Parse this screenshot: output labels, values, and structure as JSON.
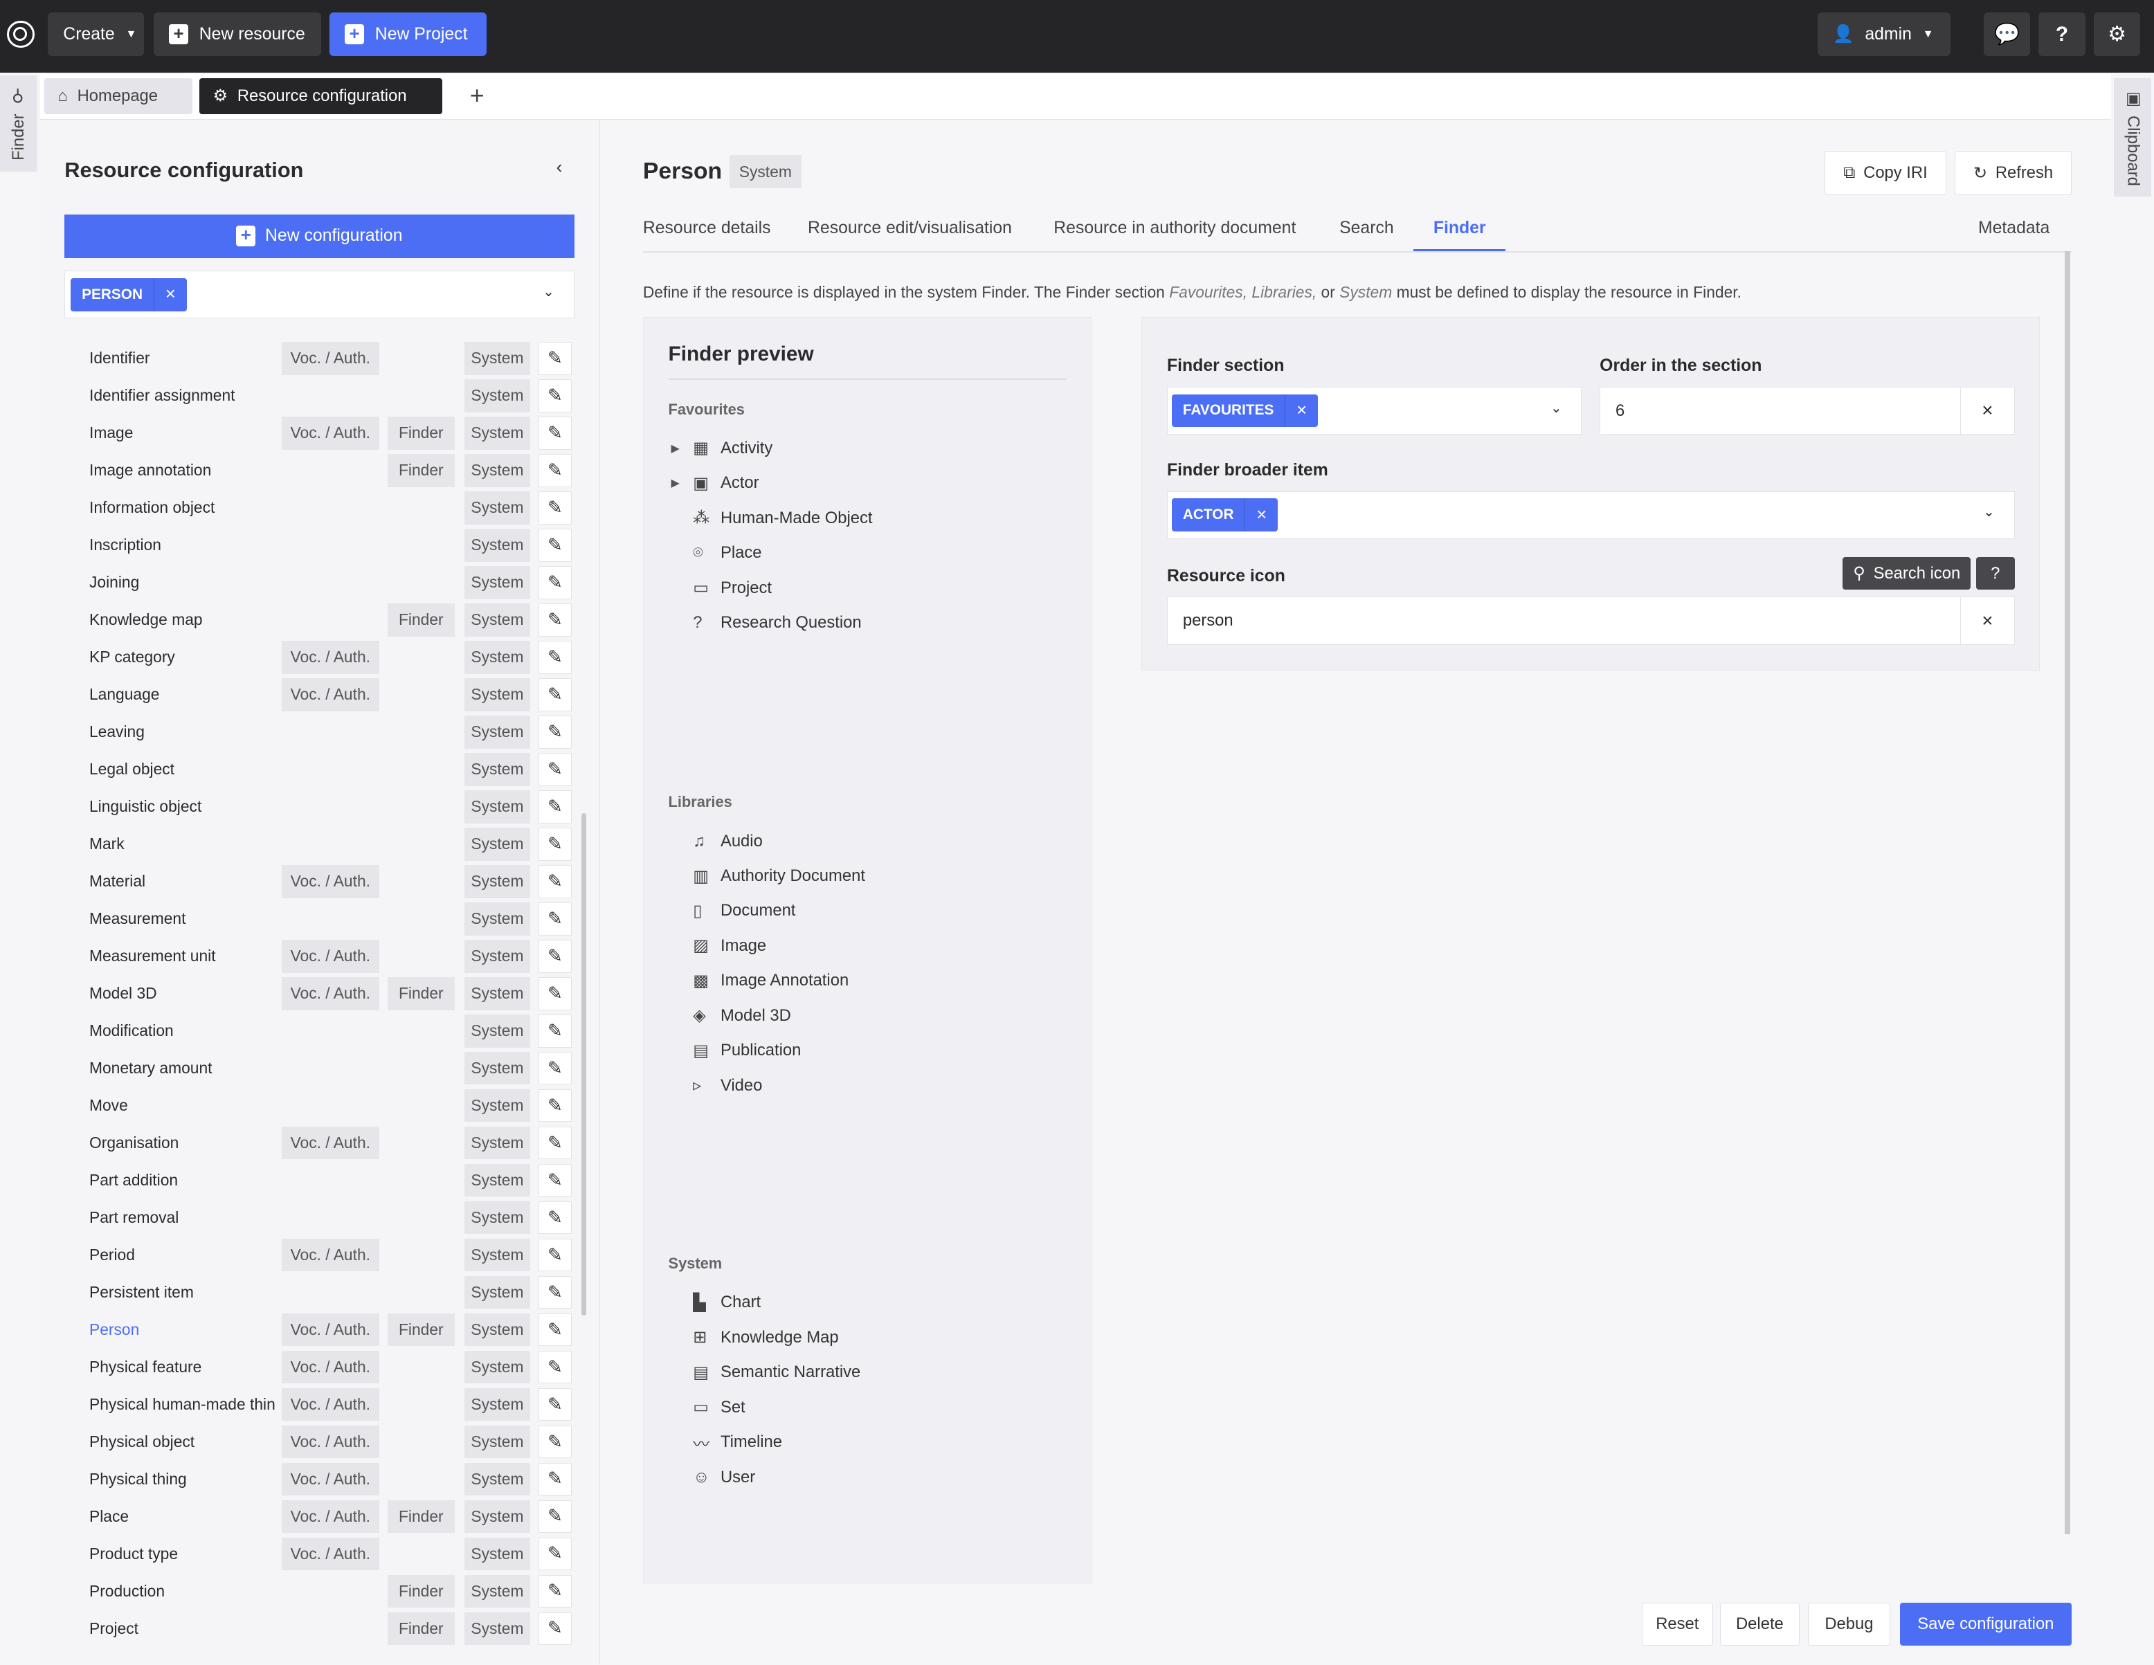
{
  "topbar": {
    "create": "Create",
    "new_resource": "New resource",
    "new_project": "New Project",
    "user": "admin"
  },
  "side_tabs": {
    "finder": "Finder",
    "clipboard": "Clipboard"
  },
  "page_tabs": [
    {
      "label": "Homepage"
    },
    {
      "label": "Resource configuration"
    }
  ],
  "left": {
    "title": "Resource configuration",
    "new_config": "New configuration",
    "filter_chip": "PERSON",
    "badges": {
      "voc": "Voc. / Auth.",
      "finder": "Finder",
      "system": "System"
    },
    "rows": [
      {
        "name": "Identifier",
        "voc": true,
        "finder": false
      },
      {
        "name": "Identifier assignment",
        "voc": false,
        "finder": false
      },
      {
        "name": "Image",
        "voc": true,
        "finder": true
      },
      {
        "name": "Image annotation",
        "voc": false,
        "finder": true
      },
      {
        "name": "Information object",
        "voc": false,
        "finder": false
      },
      {
        "name": "Inscription",
        "voc": false,
        "finder": false
      },
      {
        "name": "Joining",
        "voc": false,
        "finder": false
      },
      {
        "name": "Knowledge map",
        "voc": false,
        "finder": true
      },
      {
        "name": "KP category",
        "voc": true,
        "finder": false
      },
      {
        "name": "Language",
        "voc": true,
        "finder": false
      },
      {
        "name": "Leaving",
        "voc": false,
        "finder": false
      },
      {
        "name": "Legal object",
        "voc": false,
        "finder": false
      },
      {
        "name": "Linguistic object",
        "voc": false,
        "finder": false
      },
      {
        "name": "Mark",
        "voc": false,
        "finder": false
      },
      {
        "name": "Material",
        "voc": true,
        "finder": false
      },
      {
        "name": "Measurement",
        "voc": false,
        "finder": false
      },
      {
        "name": "Measurement unit",
        "voc": true,
        "finder": false
      },
      {
        "name": "Model 3D",
        "voc": true,
        "finder": true
      },
      {
        "name": "Modification",
        "voc": false,
        "finder": false
      },
      {
        "name": "Monetary amount",
        "voc": false,
        "finder": false
      },
      {
        "name": "Move",
        "voc": false,
        "finder": false
      },
      {
        "name": "Organisation",
        "voc": true,
        "finder": false
      },
      {
        "name": "Part addition",
        "voc": false,
        "finder": false
      },
      {
        "name": "Part removal",
        "voc": false,
        "finder": false
      },
      {
        "name": "Period",
        "voc": true,
        "finder": false
      },
      {
        "name": "Persistent item",
        "voc": false,
        "finder": false
      },
      {
        "name": "Person",
        "voc": true,
        "finder": true,
        "active": true
      },
      {
        "name": "Physical feature",
        "voc": true,
        "finder": false
      },
      {
        "name": "Physical human-made thin",
        "voc": true,
        "finder": false
      },
      {
        "name": "Physical object",
        "voc": true,
        "finder": false
      },
      {
        "name": "Physical thing",
        "voc": true,
        "finder": false
      },
      {
        "name": "Place",
        "voc": true,
        "finder": true
      },
      {
        "name": "Product type",
        "voc": true,
        "finder": false
      },
      {
        "name": "Production",
        "voc": false,
        "finder": true
      },
      {
        "name": "Project",
        "voc": false,
        "finder": true
      }
    ]
  },
  "main": {
    "title": "Person",
    "badge": "System",
    "copy_iri": "Copy IRI",
    "refresh": "Refresh",
    "tabs": [
      "Resource details",
      "Resource edit/visualisation",
      "Resource in authority document",
      "Search",
      "Finder",
      "Metadata"
    ],
    "desc": {
      "a": "Define if the resource is displayed in the system Finder. The Finder section ",
      "fav": "Favourites, Libraries,",
      "b": " or ",
      "sys": "System",
      "c": " must be defined to display the resource in Finder."
    },
    "preview": {
      "title": "Finder preview",
      "sections": [
        {
          "name": "Favourites",
          "items": [
            {
              "label": "Activity",
              "icon": "calendar-icon",
              "g": "▦",
              "exp": true
            },
            {
              "label": "Actor",
              "icon": "id-card-icon",
              "g": "▣",
              "exp": true
            },
            {
              "label": "Human-Made Object",
              "icon": "nodes-icon",
              "g": "⁂"
            },
            {
              "label": "Place",
              "icon": "map-pin-icon",
              "g": "⌾"
            },
            {
              "label": "Project",
              "icon": "briefcase-icon",
              "g": "▭"
            },
            {
              "label": "Research Question",
              "icon": "question-bulb-icon",
              "g": "?"
            }
          ]
        },
        {
          "name": "Libraries",
          "items": [
            {
              "label": "Audio",
              "icon": "audio-file-icon",
              "g": "♫"
            },
            {
              "label": "Authority Document",
              "icon": "book-icon",
              "g": "▥"
            },
            {
              "label": "Document",
              "icon": "document-icon",
              "g": "▯"
            },
            {
              "label": "Image",
              "icon": "image-icon",
              "g": "▨"
            },
            {
              "label": "Image Annotation",
              "icon": "image-annotation-icon",
              "g": "▩"
            },
            {
              "label": "Model 3D",
              "icon": "cube-icon",
              "g": "◈"
            },
            {
              "label": "Publication",
              "icon": "publication-icon",
              "g": "▤"
            },
            {
              "label": "Video",
              "icon": "video-icon",
              "g": "▹"
            }
          ]
        },
        {
          "name": "System",
          "items": [
            {
              "label": "Chart",
              "icon": "bar-chart-icon",
              "g": "▙"
            },
            {
              "label": "Knowledge Map",
              "icon": "sitemap-icon",
              "g": "⊞"
            },
            {
              "label": "Semantic Narrative",
              "icon": "narrative-icon",
              "g": "▤"
            },
            {
              "label": "Set",
              "icon": "folder-icon",
              "g": "▭"
            },
            {
              "label": "Timeline",
              "icon": "timeline-icon",
              "g": "〰"
            },
            {
              "label": "User",
              "icon": "user-icon",
              "g": "☺"
            }
          ]
        }
      ]
    },
    "form": {
      "finder_section_label": "Finder section",
      "finder_section_value": "FAVOURITES",
      "order_label": "Order in the section",
      "order_value": "6",
      "broader_label": "Finder broader item",
      "broader_value": "ACTOR",
      "icon_label": "Resource icon",
      "search_icon": "Search icon",
      "help": "?",
      "icon_value": "person"
    },
    "actions": {
      "reset": "Reset",
      "delete": "Delete",
      "debug": "Debug",
      "save": "Save configuration"
    }
  },
  "colors": {
    "accent": "#4b6ef5",
    "topbar": "#252527"
  }
}
